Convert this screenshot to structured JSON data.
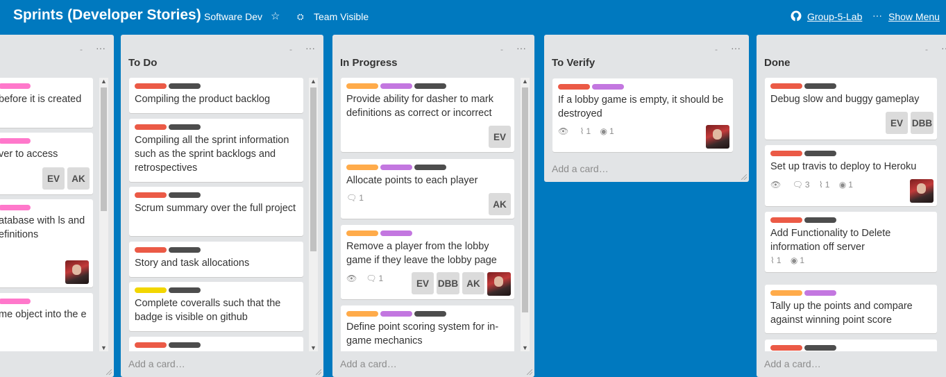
{
  "header": {
    "board_title": "Sprints (Developer Stories)",
    "team": "Software Dev",
    "visibility": "Team Visible",
    "repo_link": "Group-5-Lab",
    "menu": "Show Menu",
    "icons": {
      "star": "star-icon",
      "visibility": "team-icon",
      "github": "github-icon",
      "more": "ellipsis-icon"
    }
  },
  "colors": {
    "board_bg": "#0079bf",
    "list_bg": "#e2e4e6",
    "red": "#eb5a46",
    "dark": "#4d4d4d",
    "pink": "#ff78cb",
    "orange": "#ffab4a",
    "purple": "#c377e0",
    "yellow": "#f2d600"
  },
  "lists": [
    {
      "title": "",
      "add_card": "",
      "cards": [
        {
          "labels": [
            "pink"
          ],
          "text": "before it is created"
        },
        {
          "labels": [
            "pink"
          ],
          "text": "ver to access",
          "members": [
            "EV",
            "AK"
          ]
        },
        {
          "labels": [
            "pink"
          ],
          "text": "atabase with ls and efinitions"
        },
        {
          "labels": [
            "pink"
          ],
          "text": "me object into the e"
        }
      ]
    },
    {
      "title": "To Do",
      "add_card": "Add a card…",
      "cards": [
        {
          "labels": [
            "red",
            "dark"
          ],
          "text": "Compiling the product backlog"
        },
        {
          "labels": [
            "red",
            "dark"
          ],
          "text": "Compiling all the sprint information such as the sprint backlogs and retrospectives"
        },
        {
          "labels": [
            "red",
            "dark"
          ],
          "text": "Scrum summary over the full project"
        },
        {
          "labels": [
            "red",
            "dark"
          ],
          "text": "Story and task allocations"
        },
        {
          "labels": [
            "yellow",
            "dark"
          ],
          "text": "Complete coveralls such that the badge is visible on github"
        },
        {
          "labels": [
            "red",
            "dark"
          ],
          "text": ""
        }
      ]
    },
    {
      "title": "In Progress",
      "add_card": "Add a card…",
      "cards": [
        {
          "labels": [
            "orange",
            "purple",
            "dark"
          ],
          "text": "Provide ability for dasher to mark definitions as correct or incorrect",
          "members": [
            "EV"
          ]
        },
        {
          "labels": [
            "orange",
            "purple",
            "dark"
          ],
          "text": "Allocate points to each player",
          "comments": "1",
          "members": [
            "AK"
          ]
        },
        {
          "labels": [
            "orange",
            "purple"
          ],
          "text": "Remove a player from the lobby game if they leave the lobby page",
          "comments": "1",
          "members": [
            "EV",
            "DBB",
            "AK"
          ]
        },
        {
          "labels": [
            "orange",
            "purple",
            "dark"
          ],
          "text": "Define point scoring system for in-game mechanics"
        }
      ]
    },
    {
      "title": "To Verify",
      "add_card": "Add a card…",
      "cards": [
        {
          "labels": [
            "red",
            "purple"
          ],
          "text": "If a lobby game is empty, it should be destroyed",
          "attachments": "1",
          "github": "1"
        }
      ]
    },
    {
      "title": "Done",
      "add_card": "Add a card…",
      "cards": [
        {
          "labels": [
            "red",
            "dark"
          ],
          "text": "Debug slow and buggy gameplay",
          "members": [
            "EV",
            "DBB"
          ]
        },
        {
          "labels": [
            "red",
            "dark"
          ],
          "text": "Set up travis to deploy to Heroku",
          "comments": "3",
          "attachments": "1",
          "github": "1"
        },
        {
          "labels": [
            "red",
            "dark"
          ],
          "text": "Add Functionality to Delete information off server",
          "attachments": "1",
          "github": "1"
        },
        {
          "labels": [
            "orange",
            "purple"
          ],
          "text": "Tally up the points and compare against winning point score"
        },
        {
          "labels": [
            "red",
            "dark"
          ],
          "text": ""
        }
      ]
    }
  ]
}
